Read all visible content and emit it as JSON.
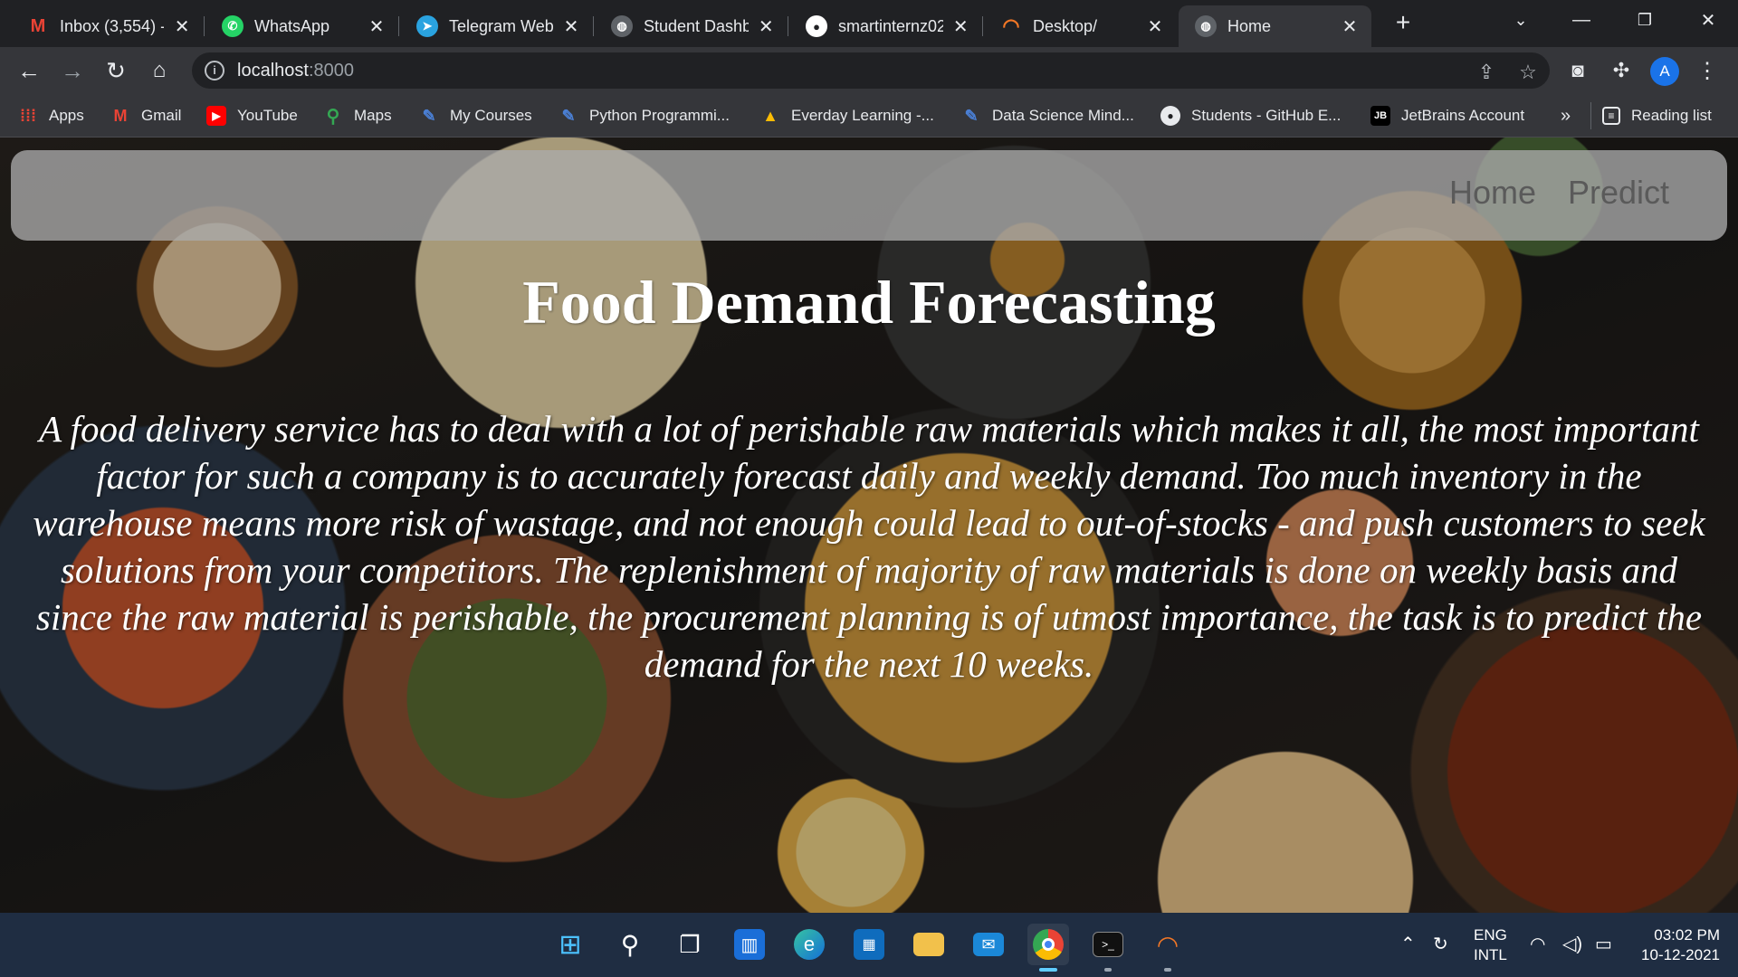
{
  "browser": {
    "tabs": [
      {
        "title": "Inbox (3,554) -",
        "icon": "gmail-icon",
        "color": "#ea4335"
      },
      {
        "title": "WhatsApp",
        "icon": "whatsapp-icon",
        "color": "#25d366"
      },
      {
        "title": "Telegram Web",
        "icon": "telegram-icon",
        "color": "#2aa3e0"
      },
      {
        "title": "Student Dashb",
        "icon": "globe-icon",
        "color": "#9aa0a6"
      },
      {
        "title": "smartinternz02",
        "icon": "github-icon",
        "color": "#ffffff"
      },
      {
        "title": "Desktop/",
        "icon": "jupyter-icon",
        "color": "#f37726"
      },
      {
        "title": "Home",
        "icon": "globe-icon",
        "color": "#9aa0a6"
      }
    ],
    "active_tab": 6,
    "address": {
      "host": "localhost",
      "port": ":8000"
    },
    "bookmarks": [
      {
        "label": "Apps",
        "icon": "apps-grid-icon"
      },
      {
        "label": "Gmail",
        "icon": "gmail-icon"
      },
      {
        "label": "YouTube",
        "icon": "youtube-icon"
      },
      {
        "label": "Maps",
        "icon": "maps-icon"
      },
      {
        "label": "My Courses",
        "icon": "feather-icon"
      },
      {
        "label": "Python Programmi...",
        "icon": "feather-icon"
      },
      {
        "label": "Everday Learning -...",
        "icon": "drive-icon"
      },
      {
        "label": "Data Science Mind...",
        "icon": "feather-icon"
      },
      {
        "label": "Students - GitHub E...",
        "icon": "github-icon"
      },
      {
        "label": "JetBrains Account",
        "icon": "jetbrains-icon"
      }
    ],
    "bookmarks_overflow": "»",
    "reading_list": "Reading list",
    "profile_initial": "A"
  },
  "page": {
    "nav": {
      "home": "Home",
      "predict": "Predict"
    },
    "title": "Food Demand Forecasting",
    "description": "A food delivery service has to deal with a lot of perishable raw materials which makes it all, the most important factor for such a company is to accurately forecast daily and weekly demand. Too much inventory in the warehouse means more risk of wastage, and not enough could lead to out-of-stocks - and push customers to seek solutions from your competitors. The replenishment of majority of raw materials is done on weekly basis and since the raw material is perishable, the procurement planning is of utmost importance, the task is to predict the demand for the next 10 weeks."
  },
  "taskbar": {
    "apps": [
      "windows-start-icon",
      "search-icon",
      "task-view-icon",
      "widgets-icon",
      "edge-icon",
      "store-icon",
      "file-explorer-icon",
      "mail-icon",
      "chrome-icon",
      "terminal-icon",
      "jupyter-icon"
    ],
    "active_app": "chrome-icon",
    "language": {
      "line1": "ENG",
      "line2": "INTL"
    },
    "time": "03:02 PM",
    "date": "10-12-2021"
  }
}
